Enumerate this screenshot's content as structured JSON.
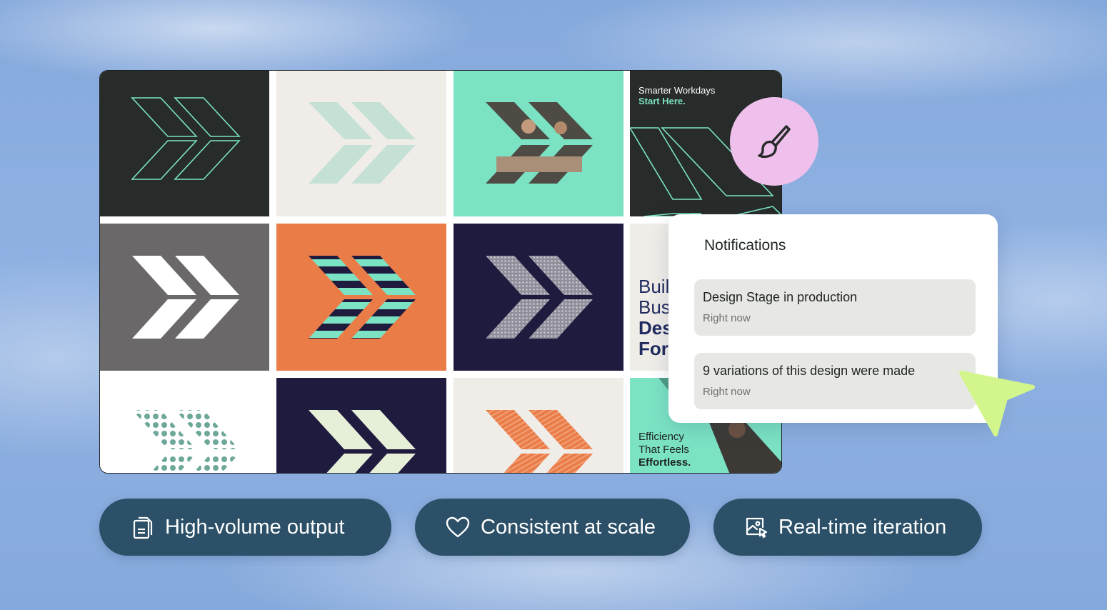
{
  "gallery": {
    "poster_top": {
      "line1": "Smarter Workdays",
      "line2": "Start Here."
    },
    "poster_mid": {
      "line1": "Buil",
      "line2": "Busi",
      "line3": "Des",
      "line4": "For"
    },
    "poster_bottom": {
      "line1": "Efficiency",
      "line2": "That Feels",
      "line3": "Effortless."
    }
  },
  "tool_icon": "paintbrush-icon",
  "notifications": {
    "title": "Notifications",
    "items": [
      {
        "message": "Design Stage in production",
        "time": "Right now"
      },
      {
        "message": "9 variations of this design were made",
        "time": "Right now"
      }
    ]
  },
  "features": [
    {
      "label": "High-volume output",
      "icon": "documents-icon"
    },
    {
      "label": "Consistent at scale",
      "icon": "heart-icon"
    },
    {
      "label": "Real-time iteration",
      "icon": "image-edit-icon"
    }
  ],
  "colors": {
    "dark": "#272b29",
    "mint": "#7be3c4",
    "orange": "#ea7c48",
    "navy": "#1e1b3e",
    "gray": "#6b686a",
    "cream": "#f0ede8",
    "pill": "#2b5068",
    "cursor": "#d2f58c",
    "brush_bg": "#f0c0ec"
  }
}
